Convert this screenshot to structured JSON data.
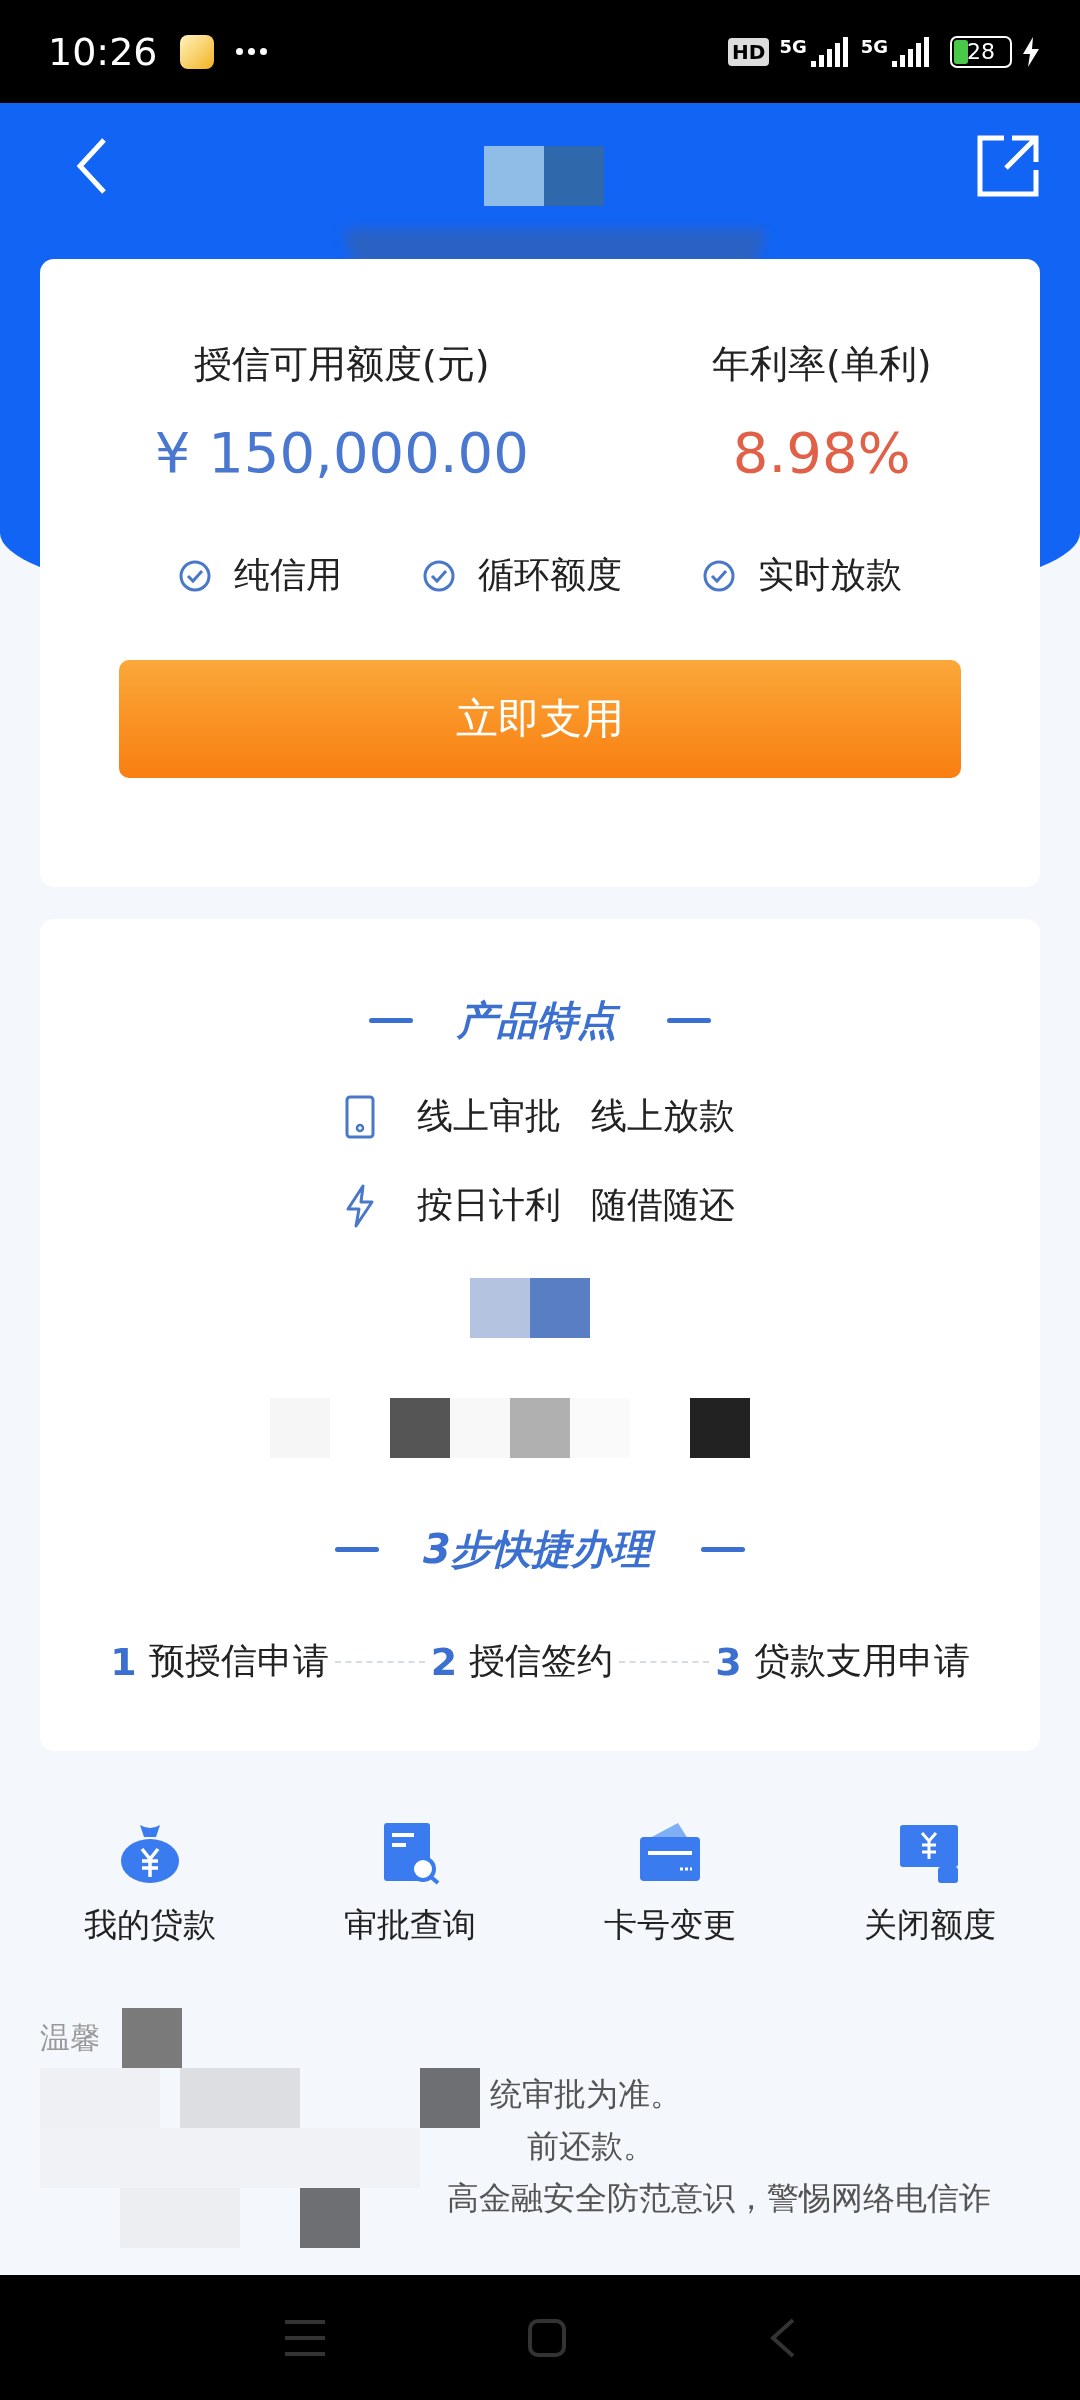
{
  "status_bar": {
    "time": "10:26",
    "hd": "HD",
    "networks": [
      "5G",
      "5G"
    ],
    "battery": "28"
  },
  "credit": {
    "limit_label": "授信可用额度(元)",
    "limit": "¥ 150,000.00",
    "rate_label": "年利率(单利)",
    "rate": "8.98%",
    "tags": [
      "纯信用",
      "循环额度",
      "实时放款"
    ],
    "button": "立即支用"
  },
  "features": {
    "title": "产品特点",
    "rows": [
      {
        "kind": "phone",
        "items": [
          "线上审批",
          "线上放款"
        ]
      },
      {
        "kind": "lightning",
        "items": [
          "按日计利",
          "随借随还"
        ]
      }
    ]
  },
  "steps": {
    "title": "3步快捷办理",
    "items": [
      {
        "number": "1",
        "label": "预授信申请"
      },
      {
        "number": "2",
        "label": "授信签约"
      },
      {
        "number": "3",
        "label": "贷款支用申请"
      }
    ]
  },
  "shortcuts": [
    {
      "kind": "money-bag",
      "label": "我的贷款"
    },
    {
      "kind": "document-search",
      "label": "审批查询"
    },
    {
      "kind": "card",
      "label": "卡号变更"
    },
    {
      "kind": "lock",
      "label": "关闭额度"
    }
  ],
  "tips": {
    "title": "温馨",
    "lines": [
      "统审批为准。",
      "前还款。",
      "高金融安全防范意识，警惕网络电信诈"
    ]
  }
}
